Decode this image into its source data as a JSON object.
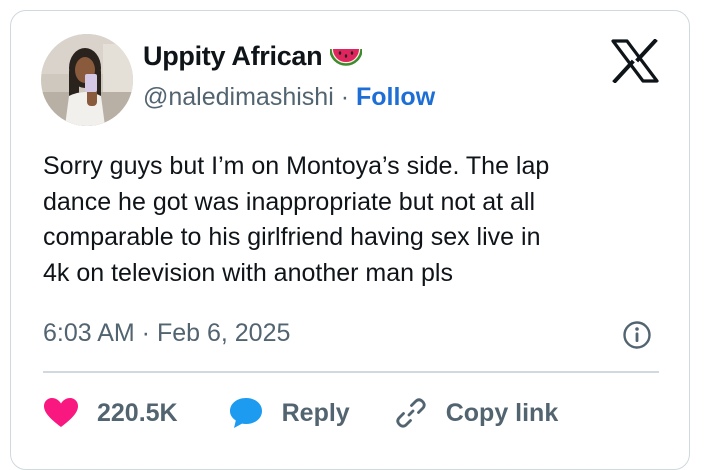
{
  "author": {
    "name": "Uppity African",
    "name_emoji": "watermelon-icon",
    "handle": "@naledimashishi",
    "separator": "·",
    "follow_label": "Follow"
  },
  "platform_icon": "x-logo-icon",
  "tweet": {
    "lines": [
      "Sorry guys but I’m on Montoya’s side. The lap",
      "dance he got was inappropriate but not at all",
      "comparable to his girlfriend having sex live in",
      "4k on television with another man pls"
    ],
    "timestamp": "6:03 AM · Feb 6, 2025"
  },
  "actions": {
    "like_count": "220.5K",
    "reply_label": "Reply",
    "copy_label": "Copy link"
  },
  "colors": {
    "link_blue": "#1d6fd6",
    "heart_red": "#f91880",
    "reply_blue": "#1d9bf0",
    "muted_text": "#536471",
    "primary_text": "#0f1419",
    "border": "#cfd9de"
  }
}
